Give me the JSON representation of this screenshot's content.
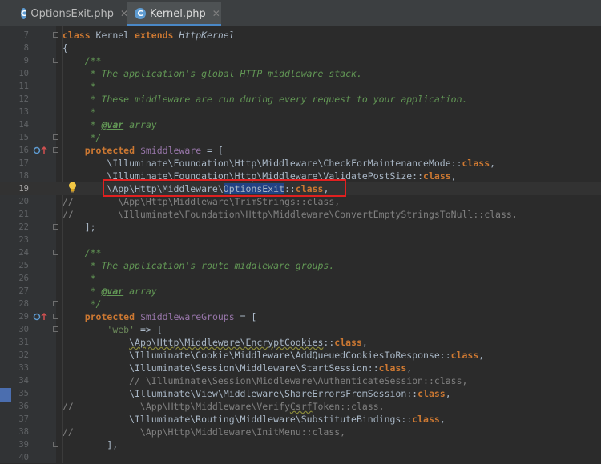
{
  "tabs": [
    {
      "label": "OptionsExit.php",
      "icon": "php-class-icon",
      "active": false
    },
    {
      "label": "Kernel.php",
      "icon": "php-class-icon",
      "active": true
    }
  ],
  "editor": {
    "lines": [
      {
        "n": "7",
        "t": "class Kernel extends HttpKernel"
      },
      {
        "n": "8",
        "t": "{"
      },
      {
        "n": "9",
        "t": "    /**"
      },
      {
        "n": "10",
        "t": "     * The application's global HTTP middleware stack."
      },
      {
        "n": "11",
        "t": "     *"
      },
      {
        "n": "12",
        "t": "     * These middleware are run during every request to your application."
      },
      {
        "n": "13",
        "t": "     *"
      },
      {
        "n": "14",
        "t": "     * @var array"
      },
      {
        "n": "15",
        "t": "     */"
      },
      {
        "n": "16",
        "t": "    protected $middleware = ["
      },
      {
        "n": "17",
        "t": "        \\Illuminate\\Foundation\\Http\\Middleware\\CheckForMaintenanceMode::class,"
      },
      {
        "n": "18",
        "t": "        \\Illuminate\\Foundation\\Http\\Middleware\\ValidatePostSize::class,"
      },
      {
        "n": "19",
        "t": "        \\App\\Http\\Middleware\\OptionsExit::class,"
      },
      {
        "n": "20",
        "t": "//        \\App\\Http\\Middleware\\TrimStrings::class,"
      },
      {
        "n": "21",
        "t": "//        \\Illuminate\\Foundation\\Http\\Middleware\\ConvertEmptyStringsToNull::class,"
      },
      {
        "n": "22",
        "t": "    ];"
      },
      {
        "n": "23",
        "t": ""
      },
      {
        "n": "24",
        "t": "    /**"
      },
      {
        "n": "25",
        "t": "     * The application's route middleware groups."
      },
      {
        "n": "26",
        "t": "     *"
      },
      {
        "n": "27",
        "t": "     * @var array"
      },
      {
        "n": "28",
        "t": "     */"
      },
      {
        "n": "29",
        "t": "    protected $middlewareGroups = ["
      },
      {
        "n": "30",
        "t": "        'web' => ["
      },
      {
        "n": "31",
        "t": "            \\App\\Http\\Middleware\\EncryptCookies::class,"
      },
      {
        "n": "32",
        "t": "            \\Illuminate\\Cookie\\Middleware\\AddQueuedCookiesToResponse::class,"
      },
      {
        "n": "33",
        "t": "            \\Illuminate\\Session\\Middleware\\StartSession::class,"
      },
      {
        "n": "34",
        "t": "            // \\Illuminate\\Session\\Middleware\\AuthenticateSession::class,"
      },
      {
        "n": "35",
        "t": "            \\Illuminate\\View\\Middleware\\ShareErrorsFromSession::class,"
      },
      {
        "n": "36",
        "t": "//            \\App\\Http\\Middleware\\VerifyCsrfToken::class,"
      },
      {
        "n": "37",
        "t": "            \\Illuminate\\Routing\\Middleware\\SubstituteBindings::class,"
      },
      {
        "n": "38",
        "t": "//            \\App\\Http\\Middleware\\InitMenu::class,"
      },
      {
        "n": "39",
        "t": "        ],"
      },
      {
        "n": "40",
        "t": ""
      }
    ]
  },
  "colors": {
    "keyword": "#cc7832",
    "doc": "#629755",
    "comment": "#808080",
    "highlight": "#e02020"
  }
}
